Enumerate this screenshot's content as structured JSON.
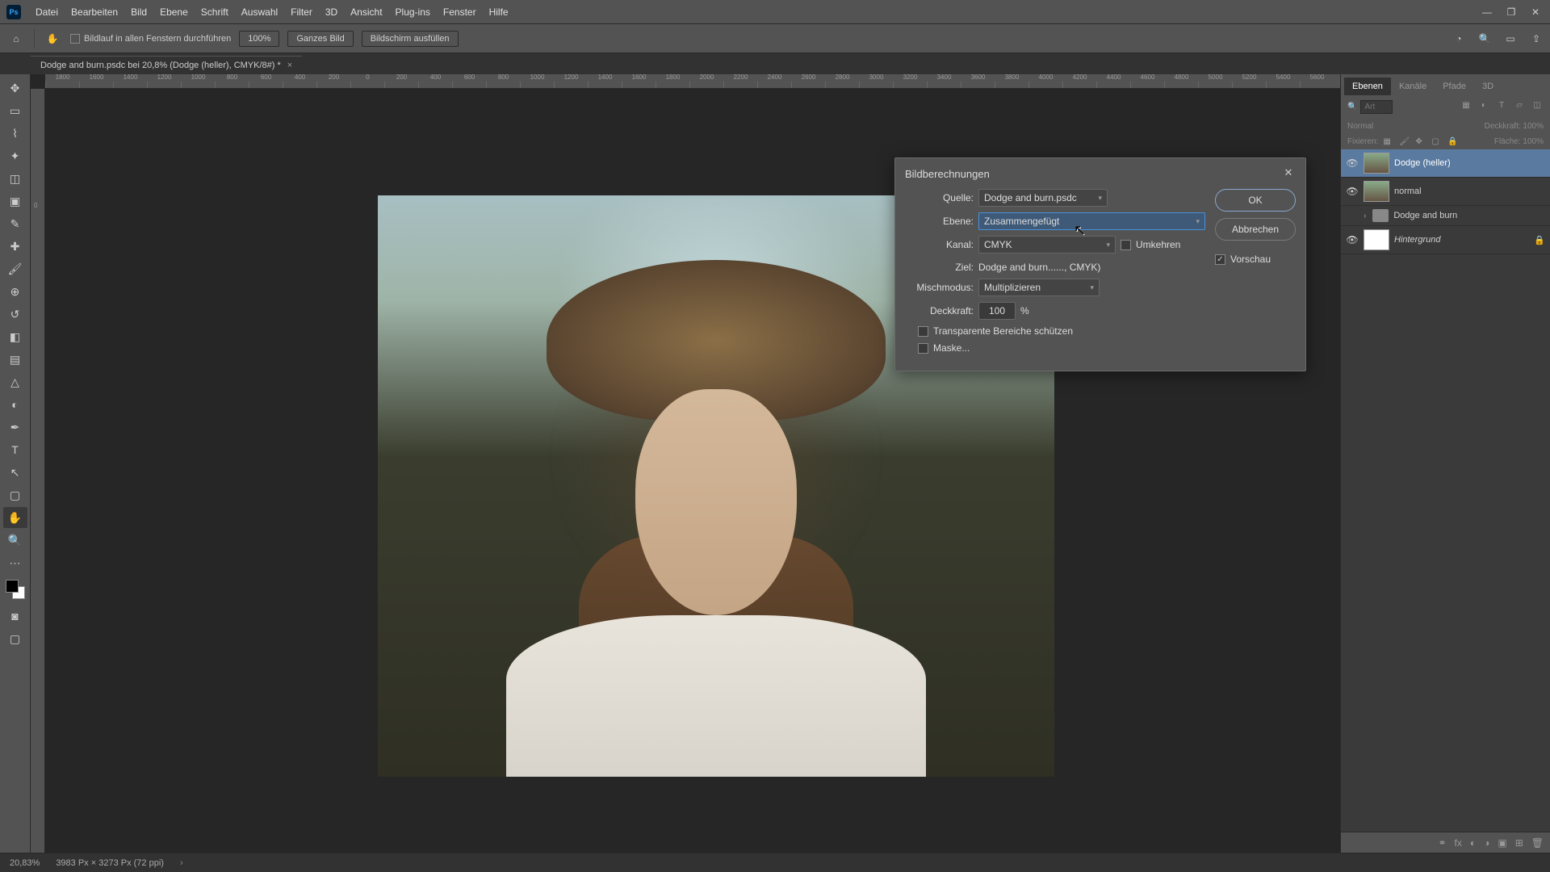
{
  "menubar": {
    "items": [
      "Datei",
      "Bearbeiten",
      "Bild",
      "Ebene",
      "Schrift",
      "Auswahl",
      "Filter",
      "3D",
      "Ansicht",
      "Plug-ins",
      "Fenster",
      "Hilfe"
    ]
  },
  "optionsbar": {
    "scroll_all": "Bildlauf in allen Fenstern durchführen",
    "zoom": "100%",
    "fit": "Ganzes Bild",
    "fill": "Bildschirm ausfüllen"
  },
  "tab": {
    "title": "Dodge and burn.psdc bei 20,8% (Dodge (heller), CMYK/8#) *"
  },
  "ruler_ticks": [
    "1800",
    "1600",
    "1400",
    "1200",
    "1000",
    "800",
    "600",
    "400",
    "200",
    "0",
    "200",
    "400",
    "600",
    "800",
    "1000",
    "1200",
    "1400",
    "1600",
    "1800",
    "2000",
    "2200",
    "2400",
    "2600",
    "2800",
    "3000",
    "3200",
    "3400",
    "3600",
    "3800",
    "4000",
    "4200",
    "4400",
    "4600",
    "4800",
    "5000",
    "5200",
    "5400",
    "5600"
  ],
  "dialog": {
    "title": "Bildberechnungen",
    "labels": {
      "source": "Quelle:",
      "layer": "Ebene:",
      "channel": "Kanal:",
      "invert": "Umkehren",
      "target": "Ziel:",
      "blend": "Mischmodus:",
      "opacity": "Deckkraft:",
      "percent": "%",
      "preserve": "Transparente Bereiche schützen",
      "mask": "Maske...",
      "ok": "OK",
      "cancel": "Abbrechen",
      "preview": "Vorschau"
    },
    "values": {
      "source": "Dodge and burn.psdc",
      "layer": "Zusammengefügt",
      "channel": "CMYK",
      "target": "Dodge and burn......, CMYK)",
      "blend": "Multiplizieren",
      "opacity": "100"
    }
  },
  "panels": {
    "tabs": [
      "Ebenen",
      "Kanäle",
      "Pfade",
      "3D"
    ],
    "search_placeholder": "Art",
    "blend_mode": "Normal",
    "opacity_label": "Deckkraft:",
    "opacity_val": "100%",
    "lock_label": "Fixieren:",
    "fill_label": "Fläche:",
    "fill_val": "100%",
    "layers": [
      {
        "name": "Dodge (heller)",
        "active": true,
        "visible": true,
        "thumb": "img"
      },
      {
        "name": "normal",
        "active": false,
        "visible": true,
        "thumb": "img"
      },
      {
        "name": "Dodge and burn",
        "active": false,
        "visible": false,
        "group": true
      },
      {
        "name": "Hintergrund",
        "active": false,
        "visible": true,
        "thumb": "white",
        "italic": true,
        "locked": true
      }
    ]
  },
  "statusbar": {
    "zoom": "20,83%",
    "doc": "3983 Px × 3273 Px (72 ppi)"
  }
}
